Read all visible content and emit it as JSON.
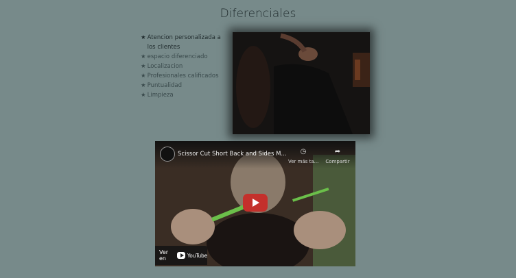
{
  "section": {
    "title": "Diferenciales"
  },
  "features": [
    {
      "star": "★",
      "text": "Atencion personalizada a los clientes"
    },
    {
      "star": "★",
      "text": "espacio diferenciado"
    },
    {
      "star": "★",
      "text": "Localizacion"
    },
    {
      "star": "★",
      "text": "Profesionales calificados"
    },
    {
      "star": "★",
      "text": "Puntualidad"
    },
    {
      "star": "★",
      "text": "Limpieza"
    }
  ],
  "video": {
    "title": "Scissor Cut Short Back and Sides M...",
    "watch_later_label": "Ver más ta...",
    "share_label": "Compartir",
    "watch_on_label": "Ver en",
    "platform_label": "YouTube"
  }
}
